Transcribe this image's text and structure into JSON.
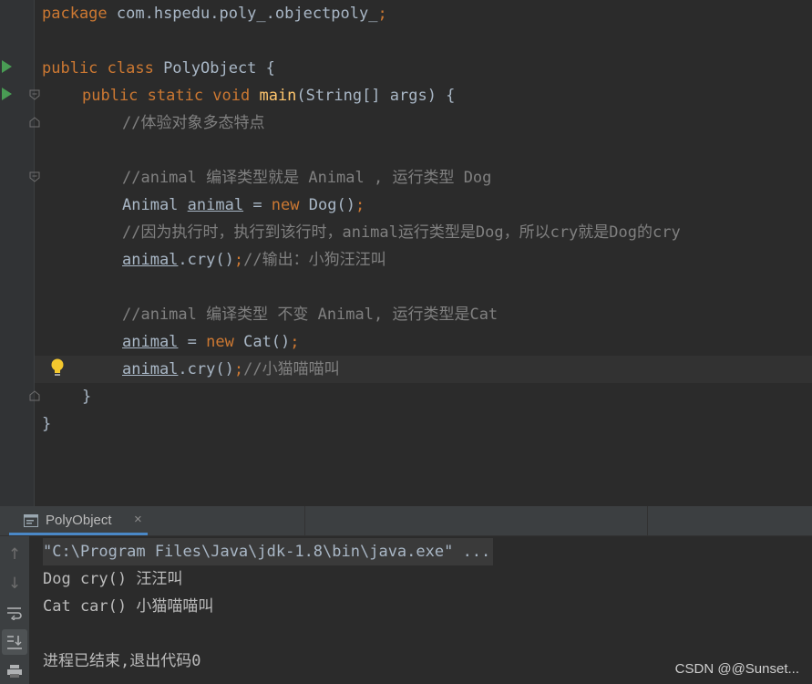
{
  "editor": {
    "lines": [
      {
        "segments": [
          {
            "t": "package ",
            "c": "kw"
          },
          {
            "t": "com.hspedu.poly_.objectpoly_",
            "c": ""
          },
          {
            "t": ";",
            "c": "kw"
          }
        ]
      },
      {
        "segments": []
      },
      {
        "segments": [
          {
            "t": "public class ",
            "c": "kw"
          },
          {
            "t": "PolyObject {",
            "c": ""
          }
        ]
      },
      {
        "segments": [
          {
            "t": "public static void ",
            "c": "kw"
          },
          {
            "t": "main",
            "c": "fn"
          },
          {
            "t": "(String[] args) {",
            "c": ""
          }
        ]
      },
      {
        "segments": [
          {
            "t": "//体验对象多态特点",
            "c": "cm"
          }
        ]
      },
      {
        "segments": []
      },
      {
        "segments": [
          {
            "t": "//animal 编译类型就是 Animal , 运行类型 Dog",
            "c": "cm"
          }
        ]
      },
      {
        "segments": [
          {
            "t": "Animal ",
            "c": ""
          },
          {
            "t": "animal",
            "c": "ul"
          },
          {
            "t": " = ",
            "c": ""
          },
          {
            "t": "new ",
            "c": "kw"
          },
          {
            "t": "Dog()",
            "c": ""
          },
          {
            "t": ";",
            "c": "kw"
          }
        ]
      },
      {
        "segments": [
          {
            "t": "//因为执行时，执行到该行时，animal运行类型是Dog，所以cry就是Dog的cry",
            "c": "cm"
          }
        ]
      },
      {
        "segments": [
          {
            "t": "animal",
            "c": "ul"
          },
          {
            "t": ".cry()",
            "c": ""
          },
          {
            "t": ";",
            "c": "kw"
          },
          {
            "t": "//输出：小狗汪汪叫",
            "c": "cm"
          }
        ]
      },
      {
        "segments": []
      },
      {
        "segments": [
          {
            "t": "//animal 编译类型 不变 Animal, 运行类型是Cat",
            "c": "cm"
          }
        ]
      },
      {
        "segments": [
          {
            "t": "animal",
            "c": "ul"
          },
          {
            "t": " = ",
            "c": ""
          },
          {
            "t": "new ",
            "c": "kw"
          },
          {
            "t": "Cat()",
            "c": ""
          },
          {
            "t": ";",
            "c": "kw"
          }
        ]
      },
      {
        "segments": [
          {
            "t": "animal",
            "c": "ul"
          },
          {
            "t": ".cry()",
            "c": ""
          },
          {
            "t": ";",
            "c": "kw"
          },
          {
            "t": "//小猫喵喵叫",
            "c": "cm"
          }
        ]
      },
      {
        "segments": [
          {
            "t": "}",
            "c": ""
          }
        ]
      },
      {
        "segments": [
          {
            "t": "}",
            "c": ""
          }
        ]
      }
    ]
  },
  "run_panel": {
    "tab_label": "PolyObject",
    "tab_close": "×",
    "toolbar_icons": [
      "up-arrow-icon",
      "down-arrow-icon",
      "soft-wrap-icon",
      "scroll-to-end-icon",
      "print-icon"
    ],
    "console_lines": [
      "\"C:\\Program Files\\Java\\jdk-1.8\\bin\\java.exe\" ...",
      "Dog cry() 汪汪叫",
      "Cat car() 小猫喵喵叫",
      "",
      "进程已结束,退出代码0"
    ]
  },
  "watermark": "CSDN @@Sunset...",
  "colors": {
    "background": "#2b2b2b",
    "keyword": "#cc7832",
    "function": "#ffc66d",
    "comment": "#808080",
    "text": "#a9b7c6",
    "run_icon": "#499c54",
    "tab_underline": "#4a88c7"
  }
}
